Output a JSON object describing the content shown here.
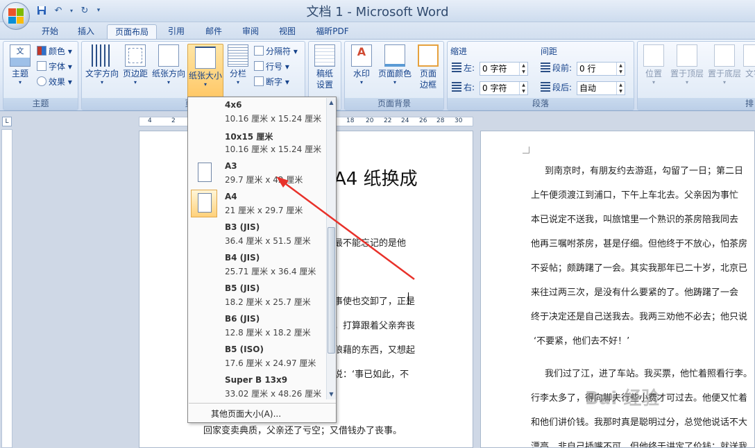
{
  "window": {
    "title": "文档 1 - Microsoft Word"
  },
  "qat": {
    "save_icon": "save-icon",
    "undo_icon": "undo-icon",
    "redo_icon": "redo-icon"
  },
  "tabs": [
    {
      "label": "开始"
    },
    {
      "label": "插入"
    },
    {
      "label": "页面布局",
      "active": true
    },
    {
      "label": "引用"
    },
    {
      "label": "邮件"
    },
    {
      "label": "审阅"
    },
    {
      "label": "视图"
    },
    {
      "label": "福昕PDF"
    }
  ],
  "ribbon": {
    "themes": {
      "label": "主题",
      "themes_btn": "主题",
      "colors": "颜色",
      "fonts": "字体",
      "effects": "效果"
    },
    "page_setup": {
      "label": "页面",
      "text_dir": "文字方向",
      "margins": "页边距",
      "orientation": "纸张方向",
      "size": "纸张大小",
      "columns": "分栏",
      "breaks": "分隔符",
      "line_numbers": "行号",
      "hyphenation": "断字"
    },
    "draft": {
      "l1": "稿纸",
      "l2": "设置"
    },
    "page_bg": {
      "label": "页面背景",
      "watermark": "水印",
      "page_color": "页面颜色",
      "borders_l1": "页面",
      "borders_l2": "边框"
    },
    "paragraph": {
      "label": "段落",
      "indent": "缩进",
      "left": "左:",
      "left_val": "0 字符",
      "right": "右:",
      "right_val": "0 字符",
      "spacing": "间距",
      "before": "段前:",
      "before_val": "0 行",
      "after": "段后:",
      "after_val": "自动"
    },
    "arrange": {
      "label": "排列",
      "position": "位置",
      "front": "置于顶层",
      "back": "置于底层",
      "wrap": "文字"
    }
  },
  "ruler": {
    "ticks": [
      "4",
      "2",
      "18",
      "20",
      "22",
      "24",
      "26",
      "28",
      "30"
    ]
  },
  "dropdown": {
    "options": [
      {
        "name": "4x6",
        "dim": "10.16 厘米 x 15.24 厘米"
      },
      {
        "name": "10x15 厘米",
        "dim": "10.16 厘米 x 15.24 厘米"
      },
      {
        "name": "A3",
        "dim": "29.7 厘米 x 42 厘米"
      },
      {
        "name": "A4",
        "dim": "21 厘米 x 29.7 厘米",
        "selected": true
      },
      {
        "name": "B3 (JIS)",
        "dim": "36.4 厘米 x 51.5 厘米"
      },
      {
        "name": "B4 (JIS)",
        "dim": "25.71 厘米 x 36.4 厘米"
      },
      {
        "name": "B5 (JIS)",
        "dim": "18.2 厘米 x 25.7 厘米"
      },
      {
        "name": "B6 (JIS)",
        "dim": "12.8 厘米 x 18.2 厘米"
      },
      {
        "name": "B5 (ISO)",
        "dim": "17.6 厘米 x 24.97 厘米"
      },
      {
        "name": "Super B 13x9",
        "dim": "33.02 厘米 x 48.26 厘米"
      }
    ],
    "more": "其他页面大小(A)..."
  },
  "page1": {
    "title": "A4 纸换成",
    "lines": [
      "最不能忘记的是他",
      "事使也交卸了，正是",
      "，打算跟着父亲奔丧",
      "狼藉的东西，又想起",
      "说：‘事已如此，不",
      "回家变卖典质，父亲还了亏空；又借钱办了丧事。"
    ]
  },
  "page2": {
    "lines": [
      "到南京时，有朋友约去游逛，勾留了一日；第二日",
      "上午便须渡江到浦口，下午上车北去。父亲因为事忙",
      "本已说定不送我，叫旅馆里一个熟识的茶房陪我同去",
      "他再三嘱咐茶房，甚是仔细。但他终于不放心，怕茶房",
      "不妥帖；颇踌躇了一会。其实我那年已二十岁，北京已",
      "来往过两三次，是没有什么要紧的了。他踌躇了一会",
      "终于决定还是自己送我去。我两三劝他不必去；他只说",
      "‘不要紧，他们去不好！’",
      "我们过了江，进了车站。我买票，他忙着照看行李。",
      "行李太多了，得向脚夫行些小费才可过去。他便又忙着",
      "和他们讲价钱。我那时真是聪明过分，总觉他说话不大",
      "漂亮，非自己插嘴不可，但他终于讲定了价钱；就送我"
    ]
  },
  "watermark": "Bai 经验",
  "colors": {
    "accent": "#15428b",
    "selected": "#ffd98b",
    "arrow": "#e8312a"
  }
}
